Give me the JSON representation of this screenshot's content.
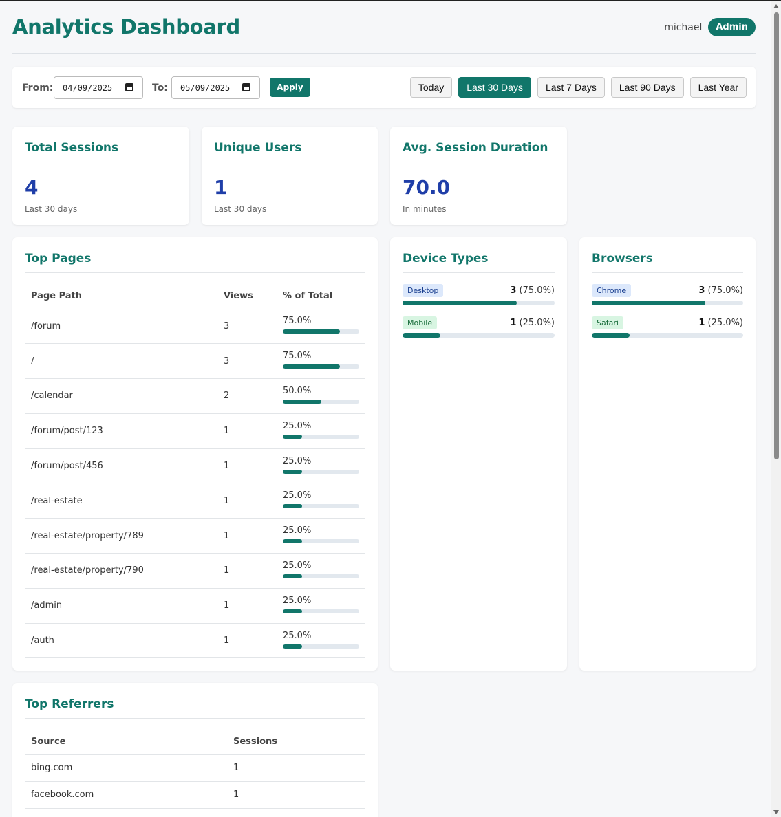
{
  "header": {
    "title": "Analytics Dashboard",
    "username": "michael",
    "role": "Admin"
  },
  "filter": {
    "from_label": "From:",
    "from_value": "04/09/2025",
    "to_label": "To:",
    "to_value": "05/09/2025",
    "apply_label": "Apply",
    "quick_ranges": [
      "Today",
      "Last 30 Days",
      "Last 7 Days",
      "Last 90 Days",
      "Last Year"
    ],
    "active_range": "Last 30 Days"
  },
  "stats": [
    {
      "title": "Total Sessions",
      "value": "4",
      "sub": "Last 30 days"
    },
    {
      "title": "Unique Users",
      "value": "1",
      "sub": "Last 30 days"
    },
    {
      "title": "Avg. Session Duration",
      "value": "70.0",
      "sub": "In minutes"
    }
  ],
  "top_pages": {
    "title": "Top Pages",
    "columns": [
      "Page Path",
      "Views",
      "% of Total"
    ],
    "rows": [
      {
        "path": "/forum",
        "views": "3",
        "pct": "75.0%",
        "fraction": 0.75
      },
      {
        "path": "/",
        "views": "3",
        "pct": "75.0%",
        "fraction": 0.75
      },
      {
        "path": "/calendar",
        "views": "2",
        "pct": "50.0%",
        "fraction": 0.5
      },
      {
        "path": "/forum/post/123",
        "views": "1",
        "pct": "25.0%",
        "fraction": 0.25
      },
      {
        "path": "/forum/post/456",
        "views": "1",
        "pct": "25.0%",
        "fraction": 0.25
      },
      {
        "path": "/real-estate",
        "views": "1",
        "pct": "25.0%",
        "fraction": 0.25
      },
      {
        "path": "/real-estate/property/789",
        "views": "1",
        "pct": "25.0%",
        "fraction": 0.25
      },
      {
        "path": "/real-estate/property/790",
        "views": "1",
        "pct": "25.0%",
        "fraction": 0.25
      },
      {
        "path": "/admin",
        "views": "1",
        "pct": "25.0%",
        "fraction": 0.25
      },
      {
        "path": "/auth",
        "views": "1",
        "pct": "25.0%",
        "fraction": 0.25
      }
    ]
  },
  "device_types": {
    "title": "Device Types",
    "items": [
      {
        "label": "Desktop",
        "count": "3",
        "pct": "(75.0%)",
        "fraction": 0.75,
        "tag_color": "blue"
      },
      {
        "label": "Mobile",
        "count": "1",
        "pct": "(25.0%)",
        "fraction": 0.25,
        "tag_color": "green"
      }
    ]
  },
  "browsers": {
    "title": "Browsers",
    "items": [
      {
        "label": "Chrome",
        "count": "3",
        "pct": "(75.0%)",
        "fraction": 0.75,
        "tag_color": "blue"
      },
      {
        "label": "Safari",
        "count": "1",
        "pct": "(25.0%)",
        "fraction": 0.25,
        "tag_color": "green"
      }
    ]
  },
  "top_referrers": {
    "title": "Top Referrers",
    "columns": [
      "Source",
      "Sessions"
    ],
    "rows": [
      {
        "source": "bing.com",
        "sessions": "1"
      },
      {
        "source": "facebook.com",
        "sessions": "1"
      }
    ]
  },
  "colors": {
    "accent": "#11766a",
    "stat_value": "#1f3ea8",
    "background": "#f6f7f9"
  }
}
